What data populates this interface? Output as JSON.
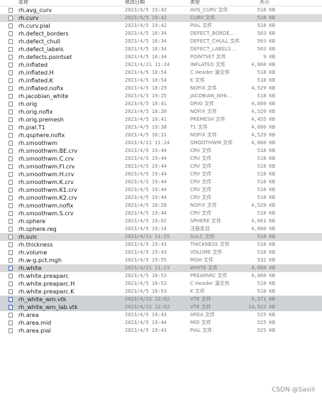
{
  "header": {
    "name": "名称",
    "date": "修改日期",
    "type": "类型",
    "size": "大小"
  },
  "files": [
    {
      "name": "rh.avg_curv",
      "date": "2023/4/5 19:42",
      "type": "AVG_CURV 文件",
      "size": "518 KB"
    },
    {
      "name": "rh.curv",
      "date": "2023/4/5 19:42",
      "type": "CURV 文件",
      "size": "518 KB",
      "selected": true
    },
    {
      "name": "rh.curv.pial",
      "date": "2023/4/5 19:42",
      "type": "PIAL 文件",
      "size": "518 KB"
    },
    {
      "name": "rh.defect_borders",
      "date": "2023/4/5 18:34",
      "type": "DEFECT_BORDE...",
      "size": "503 KB"
    },
    {
      "name": "rh.defect_chull",
      "date": "2023/4/5 18:34",
      "type": "DEFECT_CHULL 文件",
      "size": "503 KB"
    },
    {
      "name": "rh.defect_labels",
      "date": "2023/4/5 18:34",
      "type": "DEFECT_LABELS ...",
      "size": "503 KB"
    },
    {
      "name": "rh.defects.pointset",
      "date": "2023/4/5 18:34",
      "type": "POINTSET 文件",
      "size": "9 KB"
    },
    {
      "name": "rh.inflated",
      "date": "2023/4/21 11:24",
      "type": "INFLATED 文件",
      "size": "4,660 KB"
    },
    {
      "name": "rh.inflated.H",
      "date": "2023/4/5 18:54",
      "type": "C Header 源文件",
      "size": "518 KB"
    },
    {
      "name": "rh.inflated.K",
      "date": "2023/4/5 18:54",
      "type": "K 文件",
      "size": "518 KB"
    },
    {
      "name": "rh.inflated.nofix",
      "date": "2023/4/5 18:29",
      "type": "NOFIX 文件",
      "size": "4,529 KB"
    },
    {
      "name": "rh.jacobian_white",
      "date": "2023/4/5 19:25",
      "type": "JACOBIAN_WHI...",
      "size": "518 KB"
    },
    {
      "name": "rh.orig",
      "date": "2023/4/5 18:41",
      "type": "ORIG 文件",
      "size": "4,660 KB"
    },
    {
      "name": "rh.orig.nofix",
      "date": "2023/4/5 18:20",
      "type": "NOFIX 文件",
      "size": "4,529 KB"
    },
    {
      "name": "rh.orig.premesh",
      "date": "2023/4/5 18:41",
      "type": "PREMESH 文件",
      "size": "4,455 KB"
    },
    {
      "name": "rh.pial.T1",
      "date": "2023/4/5 19:38",
      "type": "T1 文件",
      "size": "4,660 KB"
    },
    {
      "name": "rh.qsphere.nofix",
      "date": "2023/4/5 18:31",
      "type": "NOFIX 文件",
      "size": "4,529 KB"
    },
    {
      "name": "rh.smoothwm",
      "date": "2023/4/21 11:24",
      "type": "SMOOTHWM 文件",
      "size": "4,660 KB"
    },
    {
      "name": "rh.smoothwm.BE.crv",
      "date": "2023/4/5 19:44",
      "type": "CRV 文件",
      "size": "518 KB"
    },
    {
      "name": "rh.smoothwm.C.crv",
      "date": "2023/4/5 19:44",
      "type": "CRV 文件",
      "size": "518 KB"
    },
    {
      "name": "rh.smoothwm.FI.crv",
      "date": "2023/4/5 19:44",
      "type": "CRV 文件",
      "size": "518 KB"
    },
    {
      "name": "rh.smoothwm.H.crv",
      "date": "2023/4/5 19:44",
      "type": "CRV 文件",
      "size": "518 KB"
    },
    {
      "name": "rh.smoothwm.K.crv",
      "date": "2023/4/5 19:44",
      "type": "CRV 文件",
      "size": "518 KB"
    },
    {
      "name": "rh.smoothwm.K1.crv",
      "date": "2023/4/5 19:44",
      "type": "CRV 文件",
      "size": "518 KB"
    },
    {
      "name": "rh.smoothwm.K2.crv",
      "date": "2023/4/5 19:44",
      "type": "CRV 文件",
      "size": "518 KB"
    },
    {
      "name": "rh.smoothwm.nofix",
      "date": "2023/4/5 18:28",
      "type": "NOFIX 文件",
      "size": "4,529 KB"
    },
    {
      "name": "rh.smoothwm.S.crv",
      "date": "2023/4/5 19:44",
      "type": "CRV 文件",
      "size": "518 KB"
    },
    {
      "name": "rh.sphere",
      "date": "2023/4/5 19:02",
      "type": "SPHERE 文件",
      "size": "4,661 KB"
    },
    {
      "name": "rh.sphere.reg",
      "date": "2023/4/5 19:14",
      "type": "注册条目",
      "size": "4,660 KB"
    },
    {
      "name": "rh.sulc",
      "date": "2023/4/21 11:25",
      "type": "SULC 文件",
      "size": "518 KB",
      "selected": true
    },
    {
      "name": "rh.thickness",
      "date": "2023/4/5 19:43",
      "type": "THICKNESS 文件",
      "size": "518 KB"
    },
    {
      "name": "rh.volume",
      "date": "2023/4/5 19:43",
      "type": "VOLUME 文件",
      "size": "518 KB"
    },
    {
      "name": "rh.w-g.pct.mgh",
      "date": "2023/4/5 19:55",
      "type": "MGH 文件",
      "size": "532 KB"
    },
    {
      "name": "rh.white",
      "date": "2023/4/21 11:23",
      "type": "WHITE 文件",
      "size": "4,660 KB",
      "selected": true,
      "special_icon": true
    },
    {
      "name": "rh.white.preaparc",
      "date": "2023/4/5 18:53",
      "type": "PREAPARC 文件",
      "size": "4,660 KB"
    },
    {
      "name": "rh.white.preaparc.H",
      "date": "2023/4/5 18:53",
      "type": "C Header 源文件",
      "size": "518 KB"
    },
    {
      "name": "rh.white.preaparc.K",
      "date": "2023/4/5 18:53",
      "type": "K 文件",
      "size": "518 KB"
    },
    {
      "name": "rh_white_wm.vtk",
      "date": "2023/4/23 12:02",
      "type": "VTK 文件",
      "size": "9,371 KB",
      "selected": true,
      "dark": true,
      "special_icon": true
    },
    {
      "name": "rh_white_wm_lab.vtk",
      "date": "2023/4/23 12:02",
      "type": "VTK 文件",
      "size": "14,922 KB",
      "selected": true,
      "dark": true,
      "special_icon": true
    },
    {
      "name": "rh.area",
      "date": "2023/4/5 19:43",
      "type": "AREA 文件",
      "size": "525 KB"
    },
    {
      "name": "rh.area.mid",
      "date": "2023/4/5 19:44",
      "type": "MID 文件",
      "size": "525 KB"
    },
    {
      "name": "rh.area.pial",
      "date": "2023/4/5 19:43",
      "type": "PIAL 文件",
      "size": "525 KB"
    }
  ],
  "watermark": "CSDN @Sasiil"
}
